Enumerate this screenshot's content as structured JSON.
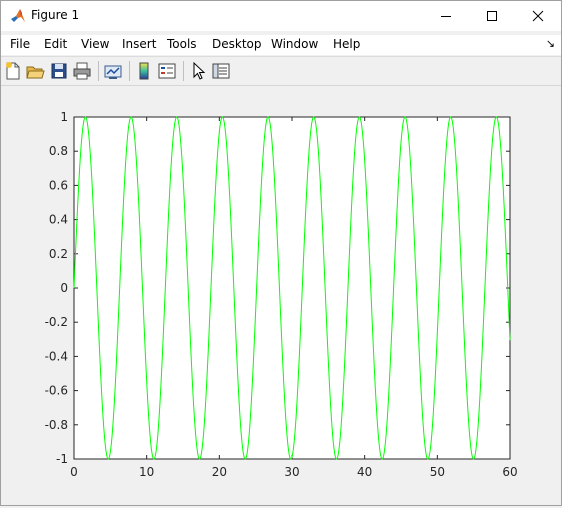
{
  "window": {
    "title": "Figure 1",
    "controls": [
      "minimize",
      "maximize",
      "close"
    ]
  },
  "menubar": {
    "items": [
      "File",
      "Edit",
      "View",
      "Insert",
      "Tools",
      "Desktop",
      "Window",
      "Help"
    ],
    "overflow_arrow": "↘"
  },
  "toolbar": {
    "buttons": [
      "new-figure-icon",
      "open-file-icon",
      "save-icon",
      "print-icon",
      "link-plot-icon",
      "insert-colorbar-icon",
      "insert-legend-icon",
      "pointer-icon",
      "property-inspector-icon"
    ]
  },
  "colors": {
    "line": "#00ff00",
    "axes_bg": "#ffffff",
    "figure_bg": "#f0f0f0"
  },
  "chart_data": {
    "type": "line",
    "title": "",
    "xlabel": "",
    "ylabel": "",
    "xlim": [
      0,
      60
    ],
    "ylim": [
      -1,
      1
    ],
    "xticks": [
      0,
      10,
      20,
      30,
      40,
      50,
      60
    ],
    "yticks": [
      -1,
      -0.8,
      -0.6,
      -0.4,
      -0.2,
      0,
      0.2,
      0.4,
      0.6,
      0.8,
      1
    ],
    "xtick_labels": [
      "0",
      "10",
      "20",
      "30",
      "40",
      "50",
      "60"
    ],
    "ytick_labels": [
      "-1",
      "-0.8",
      "-0.6",
      "-0.4",
      "-0.2",
      "0",
      "0.2",
      "0.4",
      "0.6",
      "0.8",
      "1"
    ],
    "grid": false,
    "series": [
      {
        "function": "sin(x)",
        "x_range": [
          0,
          60
        ],
        "color": "#00ff00"
      }
    ]
  }
}
